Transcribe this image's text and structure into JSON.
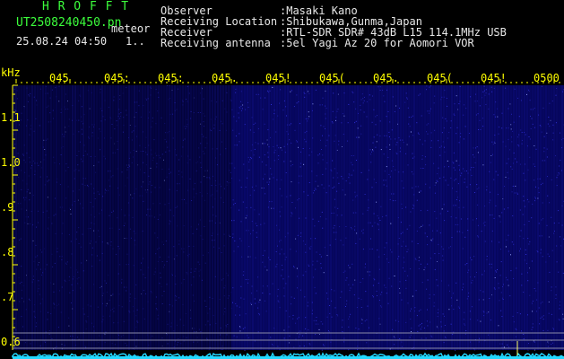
{
  "header": {
    "app_name": "H R O F F T",
    "filename": "UT2508240450.pn",
    "label_meteor": "meteor",
    "datetime": "25.08.24 04:50",
    "count": "1..",
    "info": [
      {
        "label": "Observer",
        "value": ":Masaki Kano"
      },
      {
        "label": "Receiving Location",
        "value": ":Shibukawa,Gunma,Japan"
      },
      {
        "label": "Receiver",
        "value": ":RTL-SDR SDR# 43dB L15 114.1MHz USB"
      },
      {
        "label": "Receiving antenna",
        "value": ":5el Yagi Az 20 for Aomori VOR"
      }
    ]
  },
  "time_axis": {
    "labels": [
      "045",
      "045:",
      "045:",
      "045.",
      "045!",
      "045(",
      "045.",
      "045(",
      "045!",
      "0500"
    ]
  },
  "freq_axis": {
    "unit": "kHz",
    "labels": [
      "1.1",
      "1.0",
      ".9",
      ".8",
      ".7",
      "0.6"
    ]
  },
  "colors": {
    "background": "#000000",
    "ticks": "#ffff00",
    "header_green": "#3cff3c",
    "header_white": "#e8e8e8",
    "spectrum_trace": "#22d8ff",
    "horizontal_lines": "#8a8aa8"
  }
}
